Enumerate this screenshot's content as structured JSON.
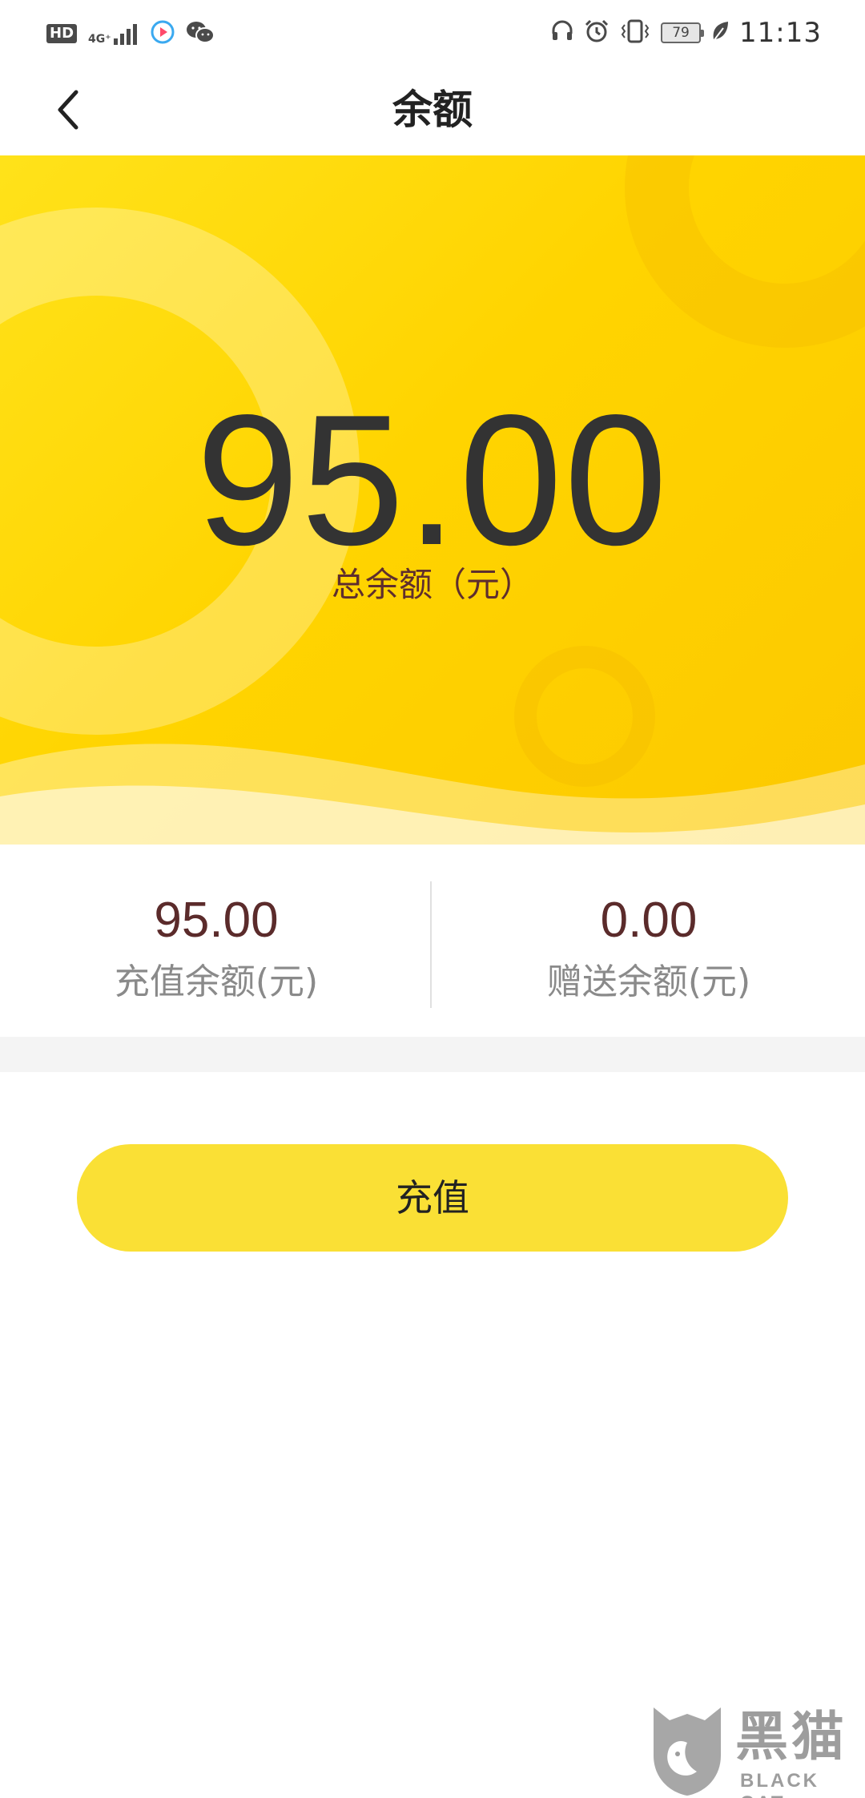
{
  "status_bar": {
    "hd_badge": "HD",
    "network": "4G⁺",
    "battery_level": "79",
    "time": "11:13"
  },
  "header": {
    "title": "余额",
    "back_icon": "chevron-left-icon"
  },
  "balance": {
    "total_amount": "95.00",
    "total_label": "总余额（元）",
    "recharge_amount": "95.00",
    "recharge_label": "充值余额(元)",
    "bonus_amount": "0.00",
    "bonus_label": "赠送余额(元)"
  },
  "actions": {
    "recharge_button": "充值"
  },
  "watermark": {
    "cn": "黑猫",
    "en": "BLACK CAT"
  },
  "colors": {
    "accent": "#ffd400",
    "button": "#fae035",
    "amount_text": "#5b2b2b",
    "label_text": "#8a8a8a"
  }
}
